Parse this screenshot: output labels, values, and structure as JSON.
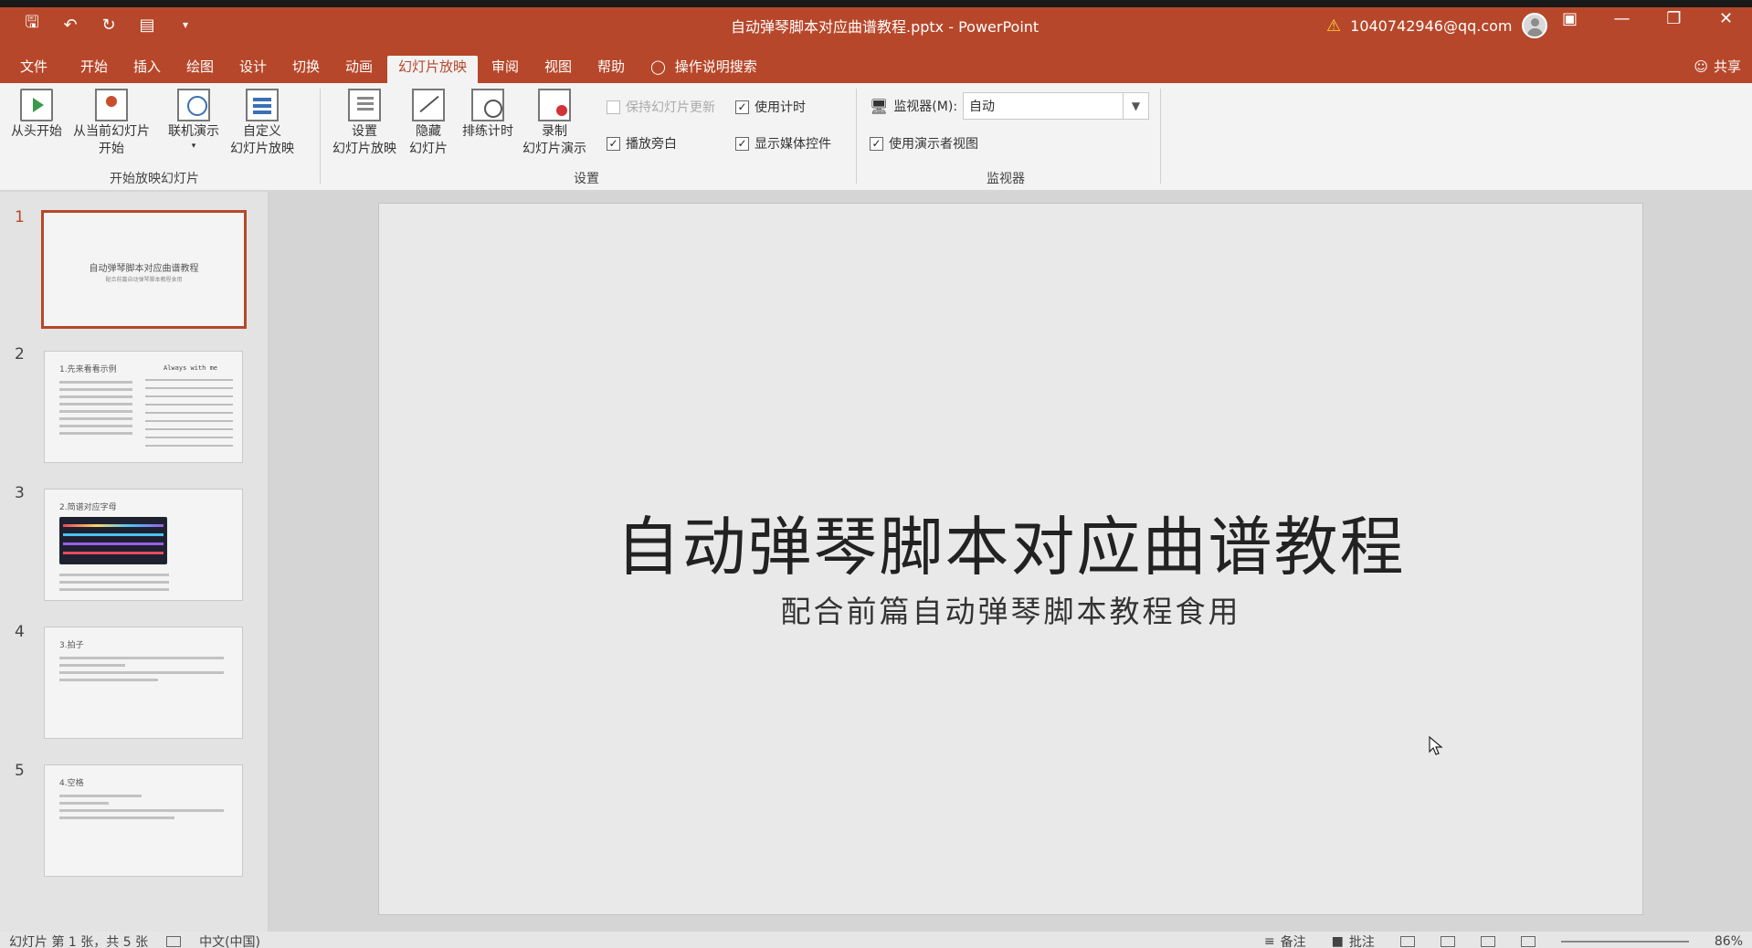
{
  "titlebar": {
    "document_title": "自动弹琴脚本对应曲谱教程.pptx  -  PowerPoint",
    "account": "1040742946@qq.com",
    "qat_icons": [
      "save-icon",
      "undo-icon",
      "redo-icon",
      "presenter-icon",
      "customize-icon"
    ]
  },
  "tabs": [
    {
      "label": "文件"
    },
    {
      "label": "开始"
    },
    {
      "label": "插入"
    },
    {
      "label": "绘图"
    },
    {
      "label": "设计"
    },
    {
      "label": "切换"
    },
    {
      "label": "动画"
    },
    {
      "label": "幻灯片放映",
      "active": true
    },
    {
      "label": "审阅"
    },
    {
      "label": "视图"
    },
    {
      "label": "帮助"
    }
  ],
  "tell_me": "操作说明搜索",
  "share": "共享",
  "ribbon": {
    "start_group": {
      "label": "开始放映幻灯片",
      "from_beginning": "从头开始",
      "from_current_1": "从当前幻灯片",
      "from_current_2": "开始",
      "online": "联机演示",
      "custom_1": "自定义",
      "custom_2": "幻灯片放映"
    },
    "setup_group": {
      "label": "设置",
      "setup_1": "设置",
      "setup_2": "幻灯片放映",
      "hide_1": "隐藏",
      "hide_2": "幻灯片",
      "rehearse": "排练计时",
      "record_1": "录制",
      "record_2": "幻灯片演示",
      "keep_updated": "保持幻灯片更新",
      "use_timings": "使用计时",
      "play_narrations": "播放旁白",
      "show_media_controls": "显示媒体控件"
    },
    "monitor_group": {
      "label": "监视器",
      "monitor_label": "监视器(M):",
      "monitor_value": "自动",
      "presenter_view": "使用演示者视图"
    }
  },
  "thumbnails": [
    {
      "number": "1",
      "title": "自动弹琴脚本对应曲谱教程",
      "subtitle": "配合前篇自动弹琴脚本教程食用"
    },
    {
      "number": "2",
      "heading": "1.先来看看示例",
      "eng": "Always with me"
    },
    {
      "number": "3",
      "heading": "2.简谱对应字母"
    },
    {
      "number": "4",
      "heading": "3.拍子"
    },
    {
      "number": "5",
      "heading": "4.空格"
    }
  ],
  "slide": {
    "title": "自动弹琴脚本对应曲谱教程",
    "subtitle": "配合前篇自动弹琴脚本教程食用"
  },
  "statusbar": {
    "slide_info": "幻灯片 第 1 张，共 5 张",
    "language": "中文(中国)",
    "notes": "备注",
    "comments": "批注",
    "zoom": "86%"
  }
}
